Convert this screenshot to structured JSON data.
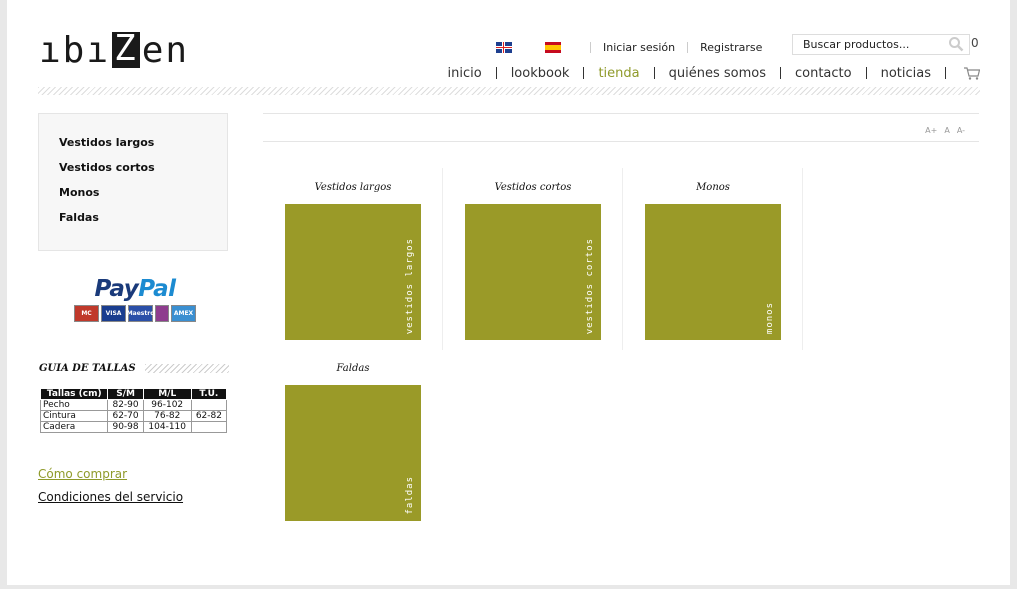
{
  "header": {
    "logo": {
      "before": "ıbı",
      "z": "Z",
      "after": "en"
    },
    "top_links": [
      "Iniciar sesión",
      "Registrarse"
    ],
    "search_placeholder": "Buscar productos...",
    "cart_count": "0",
    "nav": [
      {
        "label": "inicio",
        "active": false
      },
      {
        "label": "lookbook",
        "active": false
      },
      {
        "label": "tienda",
        "active": true
      },
      {
        "label": "quiénes somos",
        "active": false
      },
      {
        "label": "contacto",
        "active": false
      },
      {
        "label": "noticias",
        "active": false
      }
    ]
  },
  "sidebar": {
    "categories": [
      "Vestidos largos",
      "Vestidos cortos",
      "Monos",
      "Faldas"
    ],
    "paypal": {
      "pay": "Pay",
      "pal": "Pal",
      "cards": [
        "MC",
        "VISA",
        "Maestro",
        "",
        "AMEX"
      ]
    },
    "size_guide": {
      "title": "GUIA DE TALLAS",
      "headers": [
        "Tallas (cm)",
        "S/M",
        "M/L",
        "T.U."
      ],
      "rows": [
        [
          "Pecho",
          "82-90",
          "96-102",
          ""
        ],
        [
          "Cintura",
          "62-70",
          "76-82",
          "62-82"
        ],
        [
          "Cadera",
          "90-98",
          "104-110",
          ""
        ]
      ]
    },
    "links": [
      "Cómo comprar",
      "Condiciones del servicio"
    ]
  },
  "main": {
    "font_tools": [
      "A+",
      "A",
      "A-"
    ],
    "products": [
      {
        "title": "Vestidos largos",
        "image_text": "vestidos largos"
      },
      {
        "title": "Vestidos cortos",
        "image_text": "vestidos cortos"
      },
      {
        "title": "Monos",
        "image_text": "monos"
      },
      {
        "title": "Faldas",
        "image_text": "faldas"
      }
    ]
  },
  "colors": {
    "accent": "#8f9a2a",
    "product_bg": "#9a9a28"
  }
}
